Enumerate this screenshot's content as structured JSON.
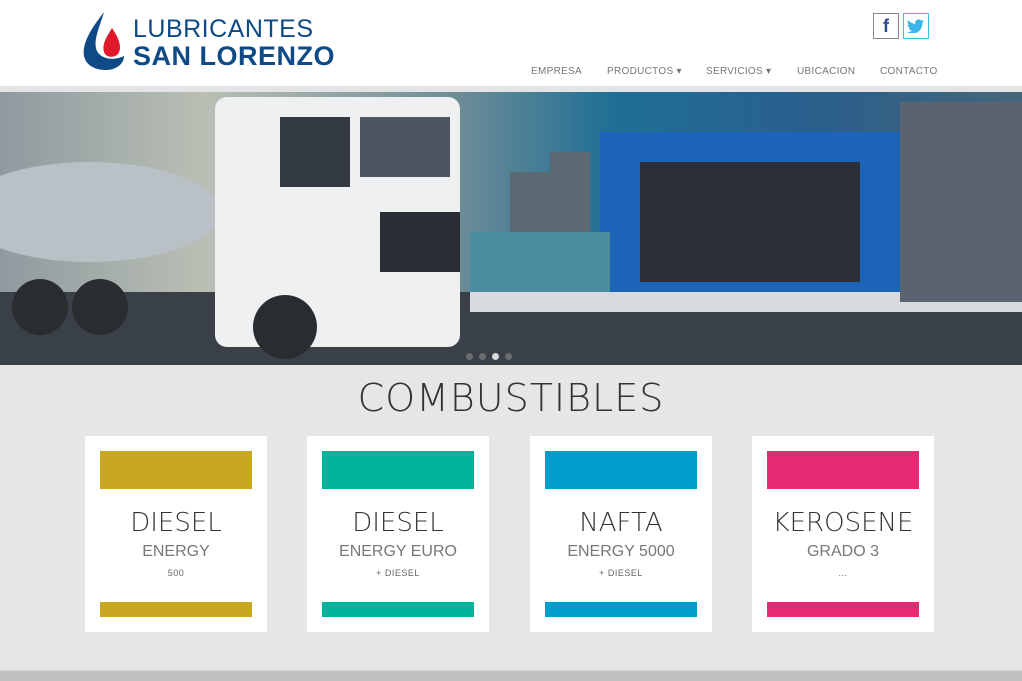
{
  "brand": {
    "line1": "LUBRICANTES",
    "line2": "SAN LORENZO",
    "color": "#0e4a86",
    "drop_color": "#e0192a"
  },
  "social": {
    "facebook": "f",
    "twitter": "twitter-bird"
  },
  "nav": [
    {
      "label": "EMPRESA"
    },
    {
      "label": "PRODUCTOS ▾"
    },
    {
      "label": "SERVICIOS ▾"
    },
    {
      "label": "UBICACION"
    },
    {
      "label": "CONTACTO"
    }
  ],
  "slider": {
    "slides": 4,
    "active": 3
  },
  "section_title": "COMBUSTIBLES",
  "products": [
    {
      "name": "DIESEL",
      "sub": "ENERGY",
      "small": "500",
      "color": "#c9a821"
    },
    {
      "name": "DIESEL",
      "sub": "ENERGY EURO",
      "small": "+ DIESEL",
      "color": "#00b59a"
    },
    {
      "name": "NAFTA",
      "sub": "ENERGY 5000",
      "small": "+ DIESEL",
      "color": "#009dcc"
    },
    {
      "name": "KEROSENE",
      "sub": "GRADO 3",
      "small": "...",
      "color": "#e52a73"
    }
  ]
}
